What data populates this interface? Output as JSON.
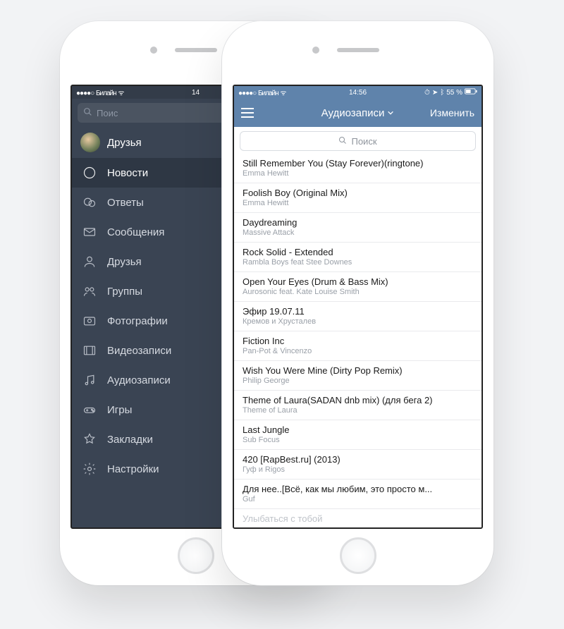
{
  "left": {
    "status": {
      "carrier": "Билайн",
      "time": "14"
    },
    "search_placeholder": "Поис",
    "profile_name": "Друзья",
    "menu": [
      {
        "icon": "news-icon",
        "label": "Новости",
        "active": true
      },
      {
        "icon": "replies-icon",
        "label": "Ответы"
      },
      {
        "icon": "messages-icon",
        "label": "Сообщения"
      },
      {
        "icon": "friends-icon",
        "label": "Друзья"
      },
      {
        "icon": "groups-icon",
        "label": "Группы"
      },
      {
        "icon": "photos-icon",
        "label": "Фотографии"
      },
      {
        "icon": "videos-icon",
        "label": "Видеозаписи"
      },
      {
        "icon": "audio-icon",
        "label": "Аудиозаписи"
      },
      {
        "icon": "games-icon",
        "label": "Игры"
      },
      {
        "icon": "bookmarks-icon",
        "label": "Закладки"
      },
      {
        "icon": "settings-icon",
        "label": "Настройки"
      }
    ]
  },
  "right": {
    "status": {
      "carrier": "Билайн",
      "time": "14:56",
      "battery": "55 %"
    },
    "navbar": {
      "title": "Аудиозаписи",
      "edit": "Изменить"
    },
    "search_placeholder": "Поиск",
    "tracks": [
      {
        "title": "Still Remember You (Stay Forever)(ringtone)",
        "artist": "Emma Hewitt"
      },
      {
        "title": "Foolish Boy (Original Mix)",
        "artist": "Emma Hewitt"
      },
      {
        "title": "Daydreaming",
        "artist": "Massive Attack"
      },
      {
        "title": "Rock Solid - Extended",
        "artist": "Rambla Boys feat Stee Downes"
      },
      {
        "title": "Open Your Eyes (Drum & Bass Mix)",
        "artist": "Aurosonic feat. Kate Louise Smith"
      },
      {
        "title": "Эфир 19.07.11",
        "artist": "Кремов и Хрусталев"
      },
      {
        "title": "Fiction Inc",
        "artist": "Pan-Pot & Vincenzo"
      },
      {
        "title": "Wish You Were Mine (Dirty Pop Remix)",
        "artist": "Philip George"
      },
      {
        "title": "Theme of Laura(SADAN dnb mix) (для бега 2)",
        "artist": "Theme of Laura"
      },
      {
        "title": "Last Jungle",
        "artist": "Sub Focus"
      },
      {
        "title": "420 [RapBest.ru] (2013)",
        "artist": "Гуф и Rigos"
      },
      {
        "title": "Для нее..[Всё, как мы любим, это просто м...",
        "artist": "Guf"
      },
      {
        "title": "Улыбаться с тобой",
        "artist": ""
      }
    ]
  }
}
